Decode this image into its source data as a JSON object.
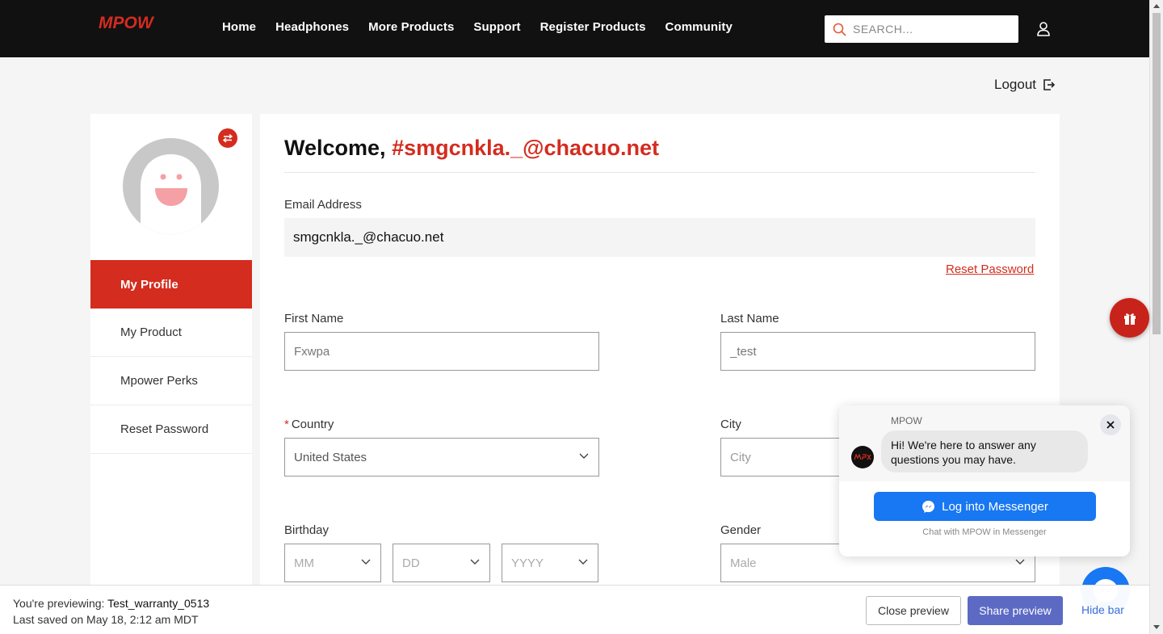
{
  "header": {
    "brand": "MPOW",
    "nav": [
      "Home",
      "Headphones",
      "More Products",
      "Support",
      "Register Products",
      "Community"
    ],
    "search_placeholder": "SEARCH..."
  },
  "account": {
    "logout": "Logout"
  },
  "sidebar": {
    "items": [
      {
        "label": "My Profile",
        "active": true
      },
      {
        "label": "My Product"
      },
      {
        "label": "Mpower Perks"
      },
      {
        "label": "Reset Password"
      }
    ]
  },
  "profile": {
    "welcome_prefix": "Welcome,",
    "welcome_user": "#smgcnkla._@chacuo.net",
    "email_label": "Email Address",
    "email_value": "smgcnkla._@chacuo.net",
    "reset_password": "Reset Password",
    "first_name_label": "First Name",
    "first_name_value": "Fxwpa",
    "last_name_label": "Last Name",
    "last_name_value": "_test",
    "country_required": "*",
    "country_label": "Country",
    "country_value": "United States",
    "city_label": "City",
    "city_placeholder": "City",
    "birthday_label": "Birthday",
    "birth_month_placeholder": "MM",
    "birth_day_placeholder": "DD",
    "birth_year_placeholder": "YYYY",
    "gender_label": "Gender",
    "gender_value": "Male"
  },
  "messenger": {
    "page_name": "MPOW",
    "greeting": "Hi! We're here to answer any questions you may have.",
    "login_button": "Log into Messenger",
    "subtext": "Chat with MPOW in Messenger"
  },
  "preview_bar": {
    "previewing_prefix": "You're previewing:",
    "theme_name": "Test_warranty_0513",
    "last_saved": "Last saved on May 18, 2:12 am MDT",
    "close_preview": "Close preview",
    "share_preview": "Share preview",
    "hide_bar": "Hide bar"
  },
  "colors": {
    "brand_red": "#d42c1f",
    "header_bg": "#111111",
    "messenger_blue": "#1877f2",
    "share_purple": "#5c6ac4"
  }
}
